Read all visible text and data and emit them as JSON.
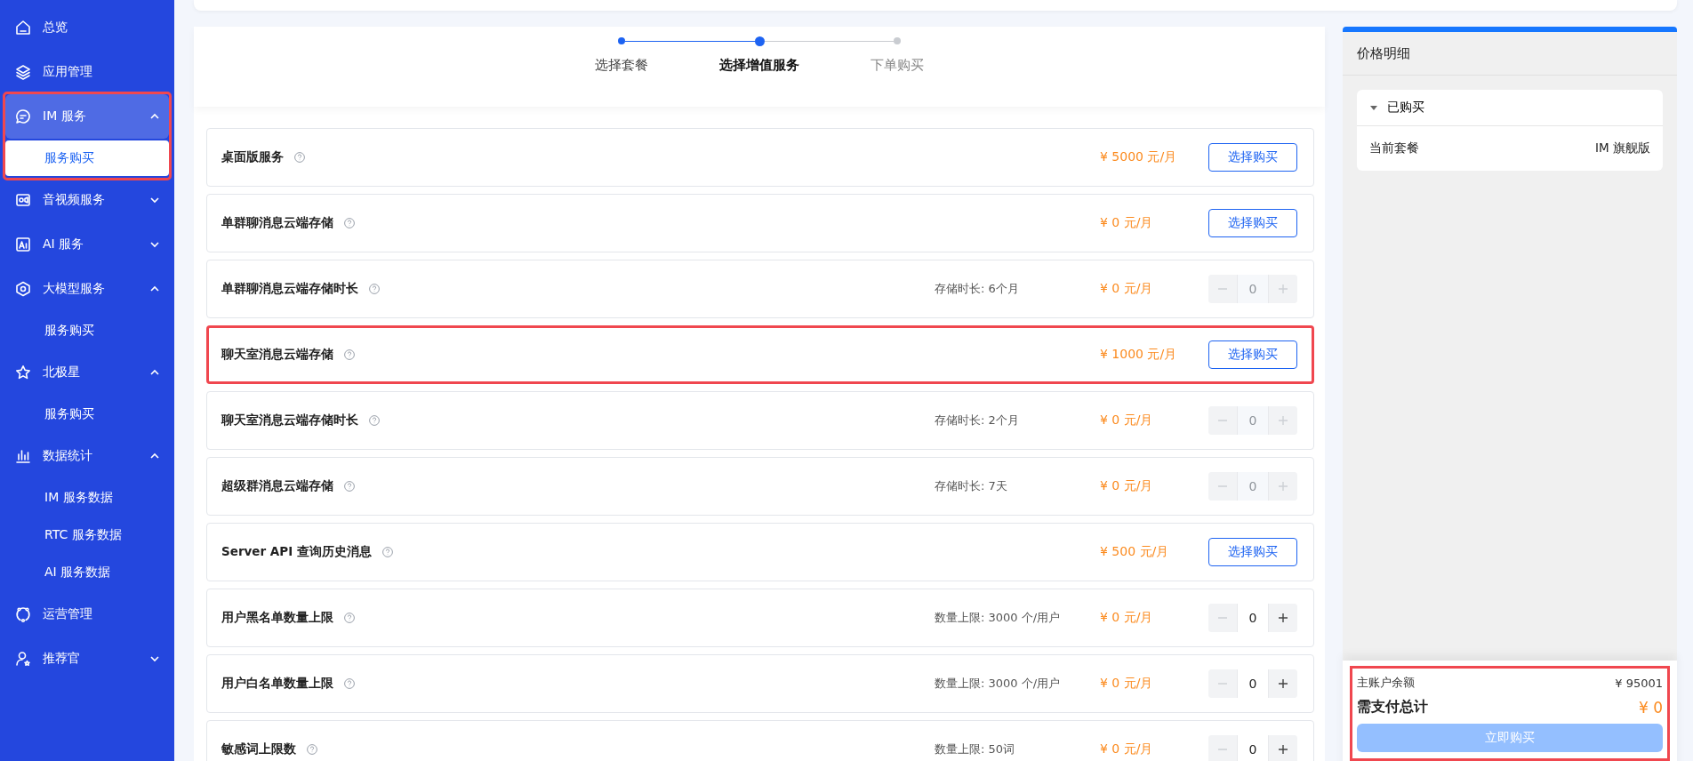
{
  "sidebar": {
    "items": [
      {
        "label": "总览",
        "selected": false,
        "highlighted": false
      },
      {
        "label": "应用管理",
        "selected": false,
        "highlighted": false
      },
      {
        "label": "IM 服务",
        "selected": true,
        "expanded": true,
        "highlighted": true,
        "children": [
          {
            "label": "服务购买",
            "selected": true
          }
        ]
      },
      {
        "label": "音视频服务",
        "selected": false,
        "expanded": false,
        "highlighted": false
      },
      {
        "label": "AI 服务",
        "selected": false,
        "expanded": false,
        "highlighted": false
      },
      {
        "label": "大模型服务",
        "selected": false,
        "expanded": true,
        "highlighted": false,
        "children": [
          {
            "label": "服务购买",
            "selected": false
          }
        ]
      },
      {
        "label": "北极星",
        "selected": false,
        "expanded": true,
        "highlighted": false,
        "children": [
          {
            "label": "服务购买",
            "selected": false
          }
        ]
      },
      {
        "label": "数据统计",
        "selected": false,
        "expanded": true,
        "highlighted": false,
        "children": [
          {
            "label": "IM 服务数据",
            "selected": false
          },
          {
            "label": "RTC 服务数据",
            "selected": false
          },
          {
            "label": "AI 服务数据",
            "selected": false
          }
        ]
      },
      {
        "label": "运营管理",
        "selected": false,
        "highlighted": false
      },
      {
        "label": "推荐官",
        "selected": false,
        "expanded": false,
        "highlighted": false
      }
    ]
  },
  "steps": [
    {
      "label": "选择套餐",
      "completed": true,
      "selected": false
    },
    {
      "label": "选择增值服务",
      "completed": false,
      "selected": true
    },
    {
      "label": "下单购买",
      "completed": false,
      "selected": false
    }
  ],
  "services": [
    {
      "name": "桌面版服务",
      "price": "¥ 5000 元/月",
      "kind": "button",
      "action": "选择购买",
      "highlighted": false
    },
    {
      "name": "单群聊消息云端存储",
      "price": "¥ 0 元/月",
      "kind": "button",
      "action": "选择购买",
      "highlighted": false
    },
    {
      "name": "单群聊消息云端存储时长",
      "detail": "存储时长:  6个月",
      "price": "¥ 0 元/月",
      "kind": "stepper",
      "value": "0",
      "disabled": true,
      "highlighted": false
    },
    {
      "name": "聊天室消息云端存储",
      "price": "¥ 1000 元/月",
      "kind": "button",
      "action": "选择购买",
      "highlighted": true
    },
    {
      "name": "聊天室消息云端存储时长",
      "detail": "存储时长:  2个月",
      "price": "¥ 0 元/月",
      "kind": "stepper",
      "value": "0",
      "disabled": true,
      "highlighted": false
    },
    {
      "name": "超级群消息云端存储",
      "detail": "存储时长:  7天",
      "price": "¥ 0 元/月",
      "kind": "stepper",
      "value": "0",
      "disabled": true,
      "highlighted": false
    },
    {
      "name": "Server API 查询历史消息",
      "price": "¥ 500 元/月",
      "kind": "button",
      "action": "选择购买",
      "highlighted": false
    },
    {
      "name": "用户黑名单数量上限",
      "detail": "数量上限:  3000 个/用户",
      "price": "¥ 0 元/月",
      "kind": "stepper",
      "value": "0",
      "disabled": false,
      "highlighted": false
    },
    {
      "name": "用户白名单数量上限",
      "detail": "数量上限:  3000 个/用户",
      "price": "¥ 0 元/月",
      "kind": "stepper",
      "value": "0",
      "disabled": false,
      "highlighted": false
    },
    {
      "name": "敏感词上限数",
      "detail": "数量上限:  50词",
      "price": "¥ 0 元/月",
      "kind": "stepper",
      "value": "0",
      "disabled": false,
      "highlighted": false
    }
  ],
  "price_panel": {
    "title": "价格明细",
    "section": {
      "title": "已购买",
      "expanded": true,
      "rows": [
        {
          "label": "当前套餐",
          "value": "IM 旗舰版"
        }
      ]
    },
    "footer": {
      "highlighted": true,
      "balance_label": "主账户余额",
      "balance": "¥ 95001",
      "total_label": "需支付总计",
      "total": "¥ 0",
      "button": {
        "label": "立即购买",
        "disabled": true
      }
    }
  }
}
